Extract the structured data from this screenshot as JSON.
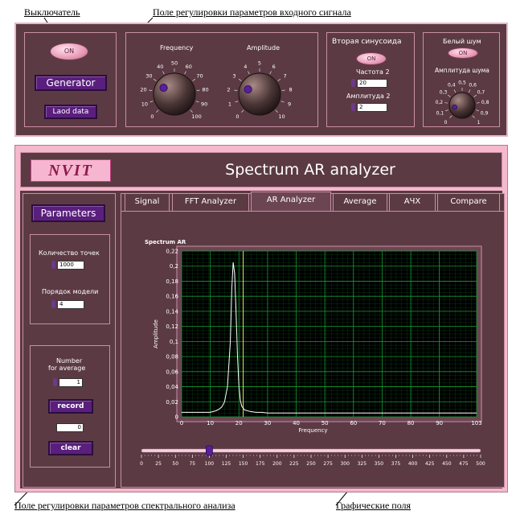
{
  "annotations": {
    "switch": "Выключатель",
    "input_params": "Поле регулировки параметров входного сигнала",
    "spectral_params": "Поле регулировки параметров спектрального анализа",
    "graph_fields": "Графические поля"
  },
  "generator": {
    "on_label": "ON",
    "generator_label": "Generator",
    "load_data_label": "Laod data"
  },
  "knobs": {
    "frequency": {
      "label": "Frequency",
      "ticks": [
        "0",
        "10",
        "20",
        "30",
        "40",
        "50",
        "60",
        "70",
        "80",
        "90",
        "100"
      ],
      "value": 28
    },
    "amplitude": {
      "label": "Amplitude",
      "ticks": [
        "0",
        "1",
        "2",
        "3",
        "4",
        "5",
        "6",
        "7",
        "8",
        "9",
        "10"
      ],
      "value": 2.5
    }
  },
  "second_sine": {
    "title": "Вторая синусоида",
    "on_label": "ON",
    "freq_label": "Частота 2",
    "freq_value": "20",
    "amp_label": "Амплитуда 2",
    "amp_value": "2"
  },
  "noise": {
    "title": "Белый шум",
    "on_label": "ON",
    "amp_label": "Амплитуда шума",
    "ticks": [
      "0",
      "0,1",
      "0,2",
      "0,3",
      "0,4",
      "0,5",
      "0,6",
      "0,7",
      "0,8",
      "0,9",
      "1"
    ],
    "value": 0.12
  },
  "header": {
    "logo_text": "NVIT",
    "title": "Spectrum AR analyzer"
  },
  "sidebar": {
    "parameters_label": "Parameters",
    "points_label": "Количество точек",
    "points_value": "1000",
    "order_label": "Порядок модели",
    "order_value": "4",
    "avg_label_1": "Number",
    "avg_label_2": "for average",
    "avg_value": "1",
    "record_label": "record",
    "counter_value": "0",
    "clear_label": "clear"
  },
  "tabs": [
    "Signal",
    "FFT Analyzer",
    "AR Analyzer",
    "Average",
    "АЧХ",
    "Compare"
  ],
  "active_tab": 2,
  "slider": {
    "ticks": [
      "0",
      "25",
      "50",
      "75",
      "100",
      "125",
      "150",
      "175",
      "200",
      "225",
      "250",
      "275",
      "300",
      "325",
      "350",
      "375",
      "400",
      "425",
      "450",
      "475",
      "500"
    ],
    "value": 100
  },
  "chart_data": {
    "type": "line",
    "title": "Spectrum AR",
    "xlabel": "Frequency",
    "ylabel": "Amplitude",
    "xlim": [
      0,
      103
    ],
    "ylim": [
      0,
      0.22
    ],
    "x_ticks": [
      "0",
      "10",
      "20",
      "30",
      "40",
      "50",
      "60",
      "70",
      "80",
      "90",
      "103"
    ],
    "y_ticks": [
      "0",
      "0,02",
      "0,04",
      "0,06",
      "0,08",
      "0,1",
      "0,12",
      "0,14",
      "0,16",
      "0,18",
      "0,2",
      "0,22"
    ],
    "grid": true,
    "cursor_x": 21.5,
    "series": [
      {
        "x": [
          0,
          2,
          4,
          6,
          8,
          10,
          11,
          12,
          13,
          14,
          15,
          16,
          17,
          17.5,
          18,
          18.5,
          19,
          19.5,
          20,
          20.5,
          21,
          22,
          24,
          26,
          28,
          30,
          40,
          50,
          60,
          70,
          80,
          90,
          100,
          103
        ],
        "y": [
          0.006,
          0.006,
          0.006,
          0.006,
          0.006,
          0.006,
          0.007,
          0.008,
          0.01,
          0.013,
          0.02,
          0.04,
          0.1,
          0.17,
          0.205,
          0.19,
          0.14,
          0.08,
          0.04,
          0.022,
          0.014,
          0.009,
          0.007,
          0.006,
          0.006,
          0.005,
          0.005,
          0.005,
          0.005,
          0.005,
          0.005,
          0.005,
          0.005,
          0.005
        ]
      }
    ],
    "colors": {
      "plot_bg": "#000000",
      "grid": "#0b6b22",
      "line": "#ffffff",
      "cursor": "#f2e36b"
    }
  }
}
